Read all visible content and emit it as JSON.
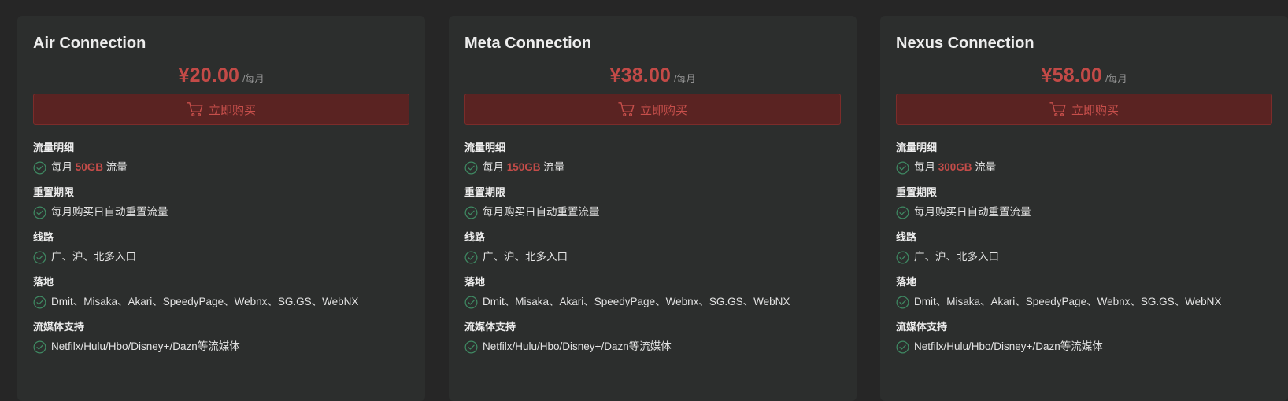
{
  "plans": [
    {
      "title": "Air Connection",
      "price": "¥20.00",
      "period": "/每月",
      "buy_label": "立即购买",
      "sections": [
        {
          "heading": "流量明细",
          "pre": "每月 ",
          "highlight": "50GB",
          "post": " 流量"
        },
        {
          "heading": "重置期限",
          "text": "每月购买日自动重置流量"
        },
        {
          "heading": "线路",
          "text": "广、沪、北多入口"
        },
        {
          "heading": "落地",
          "text": "Dmit、Misaka、Akari、SpeedyPage、Webnx、SG.GS、WebNX"
        },
        {
          "heading": "流媒体支持",
          "text": "Netfilx/Hulu/Hbo/Disney+/Dazn等流媒体"
        }
      ]
    },
    {
      "title": "Meta Connection",
      "price": "¥38.00",
      "period": "/每月",
      "buy_label": "立即购买",
      "sections": [
        {
          "heading": "流量明细",
          "pre": "每月 ",
          "highlight": "150GB",
          "post": " 流量"
        },
        {
          "heading": "重置期限",
          "text": "每月购买日自动重置流量"
        },
        {
          "heading": "线路",
          "text": "广、沪、北多入口"
        },
        {
          "heading": "落地",
          "text": "Dmit、Misaka、Akari、SpeedyPage、Webnx、SG.GS、WebNX"
        },
        {
          "heading": "流媒体支持",
          "text": "Netfilx/Hulu/Hbo/Disney+/Dazn等流媒体"
        }
      ]
    },
    {
      "title": "Nexus Connection",
      "price": "¥58.00",
      "period": "/每月",
      "buy_label": "立即购买",
      "sections": [
        {
          "heading": "流量明细",
          "pre": "每月 ",
          "highlight": "300GB",
          "post": " 流量"
        },
        {
          "heading": "重置期限",
          "text": "每月购买日自动重置流量"
        },
        {
          "heading": "线路",
          "text": "广、沪、北多入口"
        },
        {
          "heading": "落地",
          "text": "Dmit、Misaka、Akari、SpeedyPage、Webnx、SG.GS、WebNX"
        },
        {
          "heading": "流媒体支持",
          "text": "Netfilx/Hulu/Hbo/Disney+/Dazn等流媒体"
        }
      ]
    }
  ],
  "icons": {
    "buy": "shopping-cart-icon",
    "feature": "check-circle-icon"
  },
  "colors": {
    "page_background": "#262626",
    "card_background": "#2c2e2d",
    "accent_red": "#c34a47",
    "button_background": "#5a2322",
    "check_green": "#3f8a63"
  }
}
